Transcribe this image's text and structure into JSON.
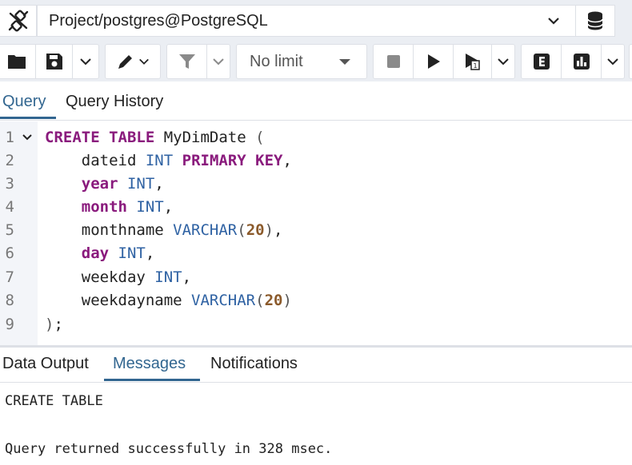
{
  "connection": {
    "label": "Project/postgres@PostgreSQL"
  },
  "toolbar": {
    "limit_label": "No limit"
  },
  "query_tabs": [
    {
      "label": "Query",
      "active": true
    },
    {
      "label": "Query History",
      "active": false
    }
  ],
  "editor": {
    "line_numbers": [
      "1",
      "2",
      "3",
      "4",
      "5",
      "6",
      "7",
      "8",
      "9"
    ]
  },
  "result_tabs": [
    {
      "label": "Data Output",
      "active": false
    },
    {
      "label": "Messages",
      "active": true
    },
    {
      "label": "Notifications",
      "active": false
    }
  ],
  "messages": {
    "line1": "CREATE TABLE",
    "line2": "Query returned successfully in 328 msec."
  },
  "colors": {
    "accent": "#326690",
    "keyword": "#8a1b7d",
    "type": "#2f62a3",
    "number": "#8b5a2b",
    "toolbar_bg": "#ebeef3"
  }
}
